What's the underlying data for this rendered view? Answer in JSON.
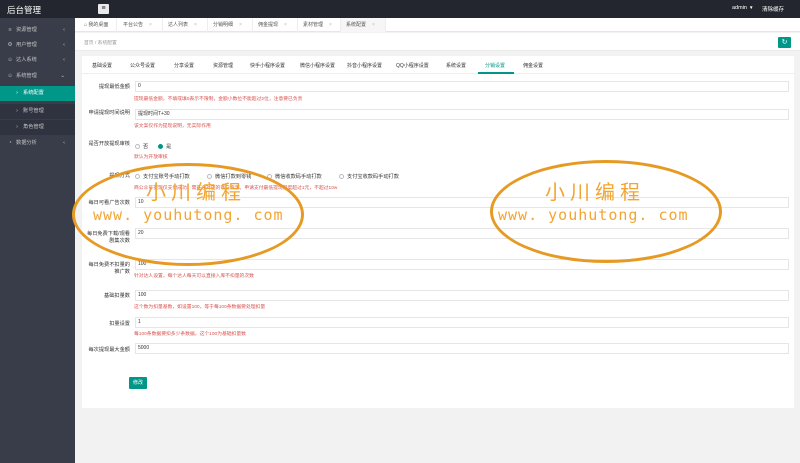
{
  "app": {
    "title": "后台管理",
    "user": "admin",
    "clear_cache": "清除缓存"
  },
  "sidebar": {
    "items": [
      {
        "label": "资源管理",
        "icon": "layers-icon"
      },
      {
        "label": "用户管理",
        "icon": "gear-icon"
      },
      {
        "label": "达人系统",
        "icon": "user-icon"
      },
      {
        "label": "系统管理",
        "icon": "user-icon"
      },
      {
        "label": "系统配置"
      },
      {
        "label": "账号管理"
      },
      {
        "label": "角色管理"
      },
      {
        "label": "数据分析",
        "icon": "chart-icon"
      }
    ]
  },
  "tabs": [
    {
      "label": "我的桌面"
    },
    {
      "label": "平台公告"
    },
    {
      "label": "达人列表"
    },
    {
      "label": "分销明细"
    },
    {
      "label": "佣金提现"
    },
    {
      "label": "素材管理"
    },
    {
      "label": "系统配置"
    }
  ],
  "breadcrumb": {
    "home": "首页",
    "sep": "/",
    "current": "系统配置"
  },
  "subtabs": [
    "基础设置",
    "公众号设置",
    "分享设置",
    "资源管理",
    "快手小程序设置",
    "微信小程序设置",
    "抖音小程序设置",
    "QQ小程序设置",
    "系统设置",
    "分销设置",
    "佣金设置"
  ],
  "form": {
    "min_withdraw": {
      "label": "提现最低金额",
      "value": "0",
      "hint": "提现最低金额，不填或填0表示不限制，金额小数位不能超过2位，注意要已负责"
    },
    "apply_desc": {
      "label": "申请提现时间说明",
      "value": "提现时间T+30",
      "hint": "该文案仅作为提现说明，无实际作用"
    },
    "review": {
      "label": "是否开放提现审核",
      "option_no": "否",
      "option_yes": "是",
      "hint": "默认为开放审核"
    },
    "method": {
      "label": "提现方式",
      "options": [
        "支付宝账号手动打款",
        "微信打款到零钱",
        "微信收款码手动打款",
        "支付宝收款码手动打款"
      ],
      "hint": "商公众号提现仅支付成功，需开通对应的商户资源。申请支付最低提现额度超过1元，不超过10w"
    },
    "daily_ads": {
      "label": "每日可看广告次数",
      "value": "10"
    },
    "daily_free": {
      "label": "每日免费下载/观看剧集次数",
      "value": "20"
    },
    "daily_limit": {
      "label": "每日免费不扣量的推广数",
      "value": "100",
      "hint": "针对达人设置，每个达人每天可以直接入库不扣量的次数"
    },
    "base_deduct": {
      "label": "基础扣量数",
      "value": "100",
      "hint": "这个数为扣量基数，如设置100，等于每100条数据要处理扣量"
    },
    "deduct": {
      "label": "扣量设置",
      "value": "1",
      "hint": "每100条数据要扣多少条数据，这个100为基础扣量数"
    },
    "max_withdraw": {
      "label": "每次提现最大金额",
      "value": "5000"
    },
    "submit": "修改"
  },
  "watermark": {
    "cn": "小川编程",
    "url": "www. youhutong. com"
  },
  "colors": {
    "accent": "#009688",
    "topbar": "#23262e",
    "sidebar": "#393d49",
    "hint": "#d9534f",
    "watermark": "#f2a532"
  }
}
